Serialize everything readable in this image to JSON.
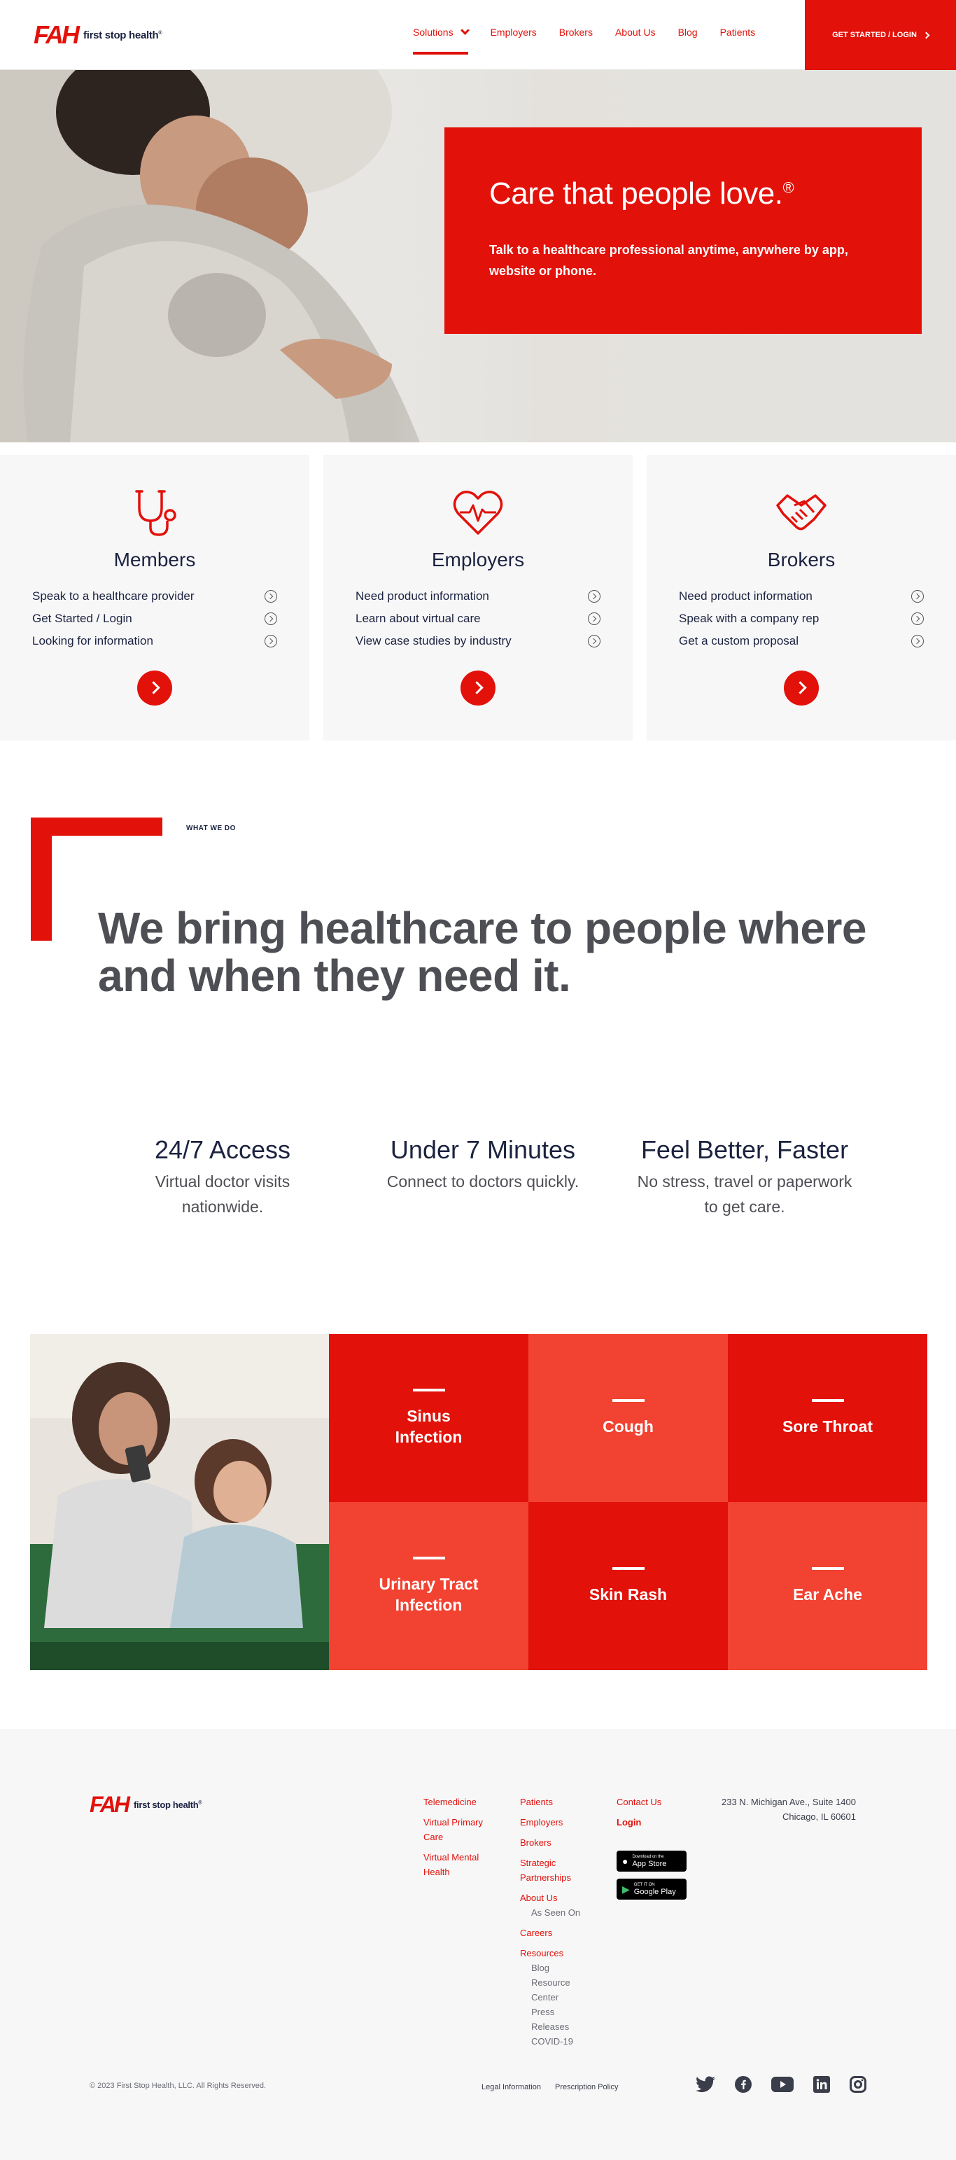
{
  "header": {
    "logo_mark": "FAH",
    "logo_text": "first stop health",
    "nav": [
      {
        "label": "Solutions"
      },
      {
        "label": "Employers"
      },
      {
        "label": "Brokers"
      },
      {
        "label": "About Us"
      },
      {
        "label": "Blog"
      },
      {
        "label": "Patients"
      }
    ],
    "cta_label": "GET STARTED / LOGIN"
  },
  "hero": {
    "title": "Care that people love.",
    "title_mark": "®",
    "subtitle": "Talk to a healthcare professional anytime, anywhere by app, website or phone."
  },
  "cards": [
    {
      "title": "Members",
      "icon": "stethoscope-icon",
      "links": [
        "Speak to a healthcare provider",
        "Get Started / Login",
        "Looking for information"
      ]
    },
    {
      "title": "Employers",
      "icon": "heart-pulse-icon",
      "links": [
        "Need product information",
        "Learn about virtual care",
        "View case studies by industry"
      ]
    },
    {
      "title": "Brokers",
      "icon": "handshake-icon",
      "links": [
        "Need product information",
        "Speak with a company rep",
        "Get a custom proposal"
      ]
    }
  ],
  "what_we_do": {
    "eyebrow": "WHAT WE DO",
    "heading": "We bring healthcare to people where and when they need it."
  },
  "stats": [
    {
      "title": "24/7 Access",
      "desc": "Virtual doctor visits nationwide."
    },
    {
      "title": "Under 7 Minutes",
      "desc": "Connect to doctors quickly."
    },
    {
      "title": "Feel Better, Faster",
      "desc": "No stress, travel or paperwork to get care."
    }
  ],
  "conditions": [
    "Sinus Infection",
    "Cough",
    "Sore Throat",
    "Urinary Tract Infection",
    "Skin Rash",
    "Ear Ache"
  ],
  "footer": {
    "col1": [
      "Telemedicine",
      "Virtual Primary Care",
      "Virtual Mental Health"
    ],
    "col2": {
      "patients": "Patients",
      "employers": "Employers",
      "brokers": "Brokers",
      "strategic": "Strategic Partnerships",
      "about": "About Us",
      "as_seen_on": "As Seen On",
      "careers": "Careers",
      "resources": "Resources",
      "blog": "Blog",
      "resource_center": "Resource Center",
      "press": "Press Releases",
      "covid": "COVID-19"
    },
    "contact": "Contact Us",
    "login": "Login",
    "app_store_small": "Download on the",
    "app_store": "App Store",
    "google_small": "GET IT ON",
    "google": "Google Play",
    "address_line1": "233 N. Michigan Ave., Suite 1400",
    "address_line2": "Chicago, IL 60601",
    "copyright": "© 2023 First Stop Health, LLC. All Rights Reserved.",
    "legal": "Legal Information",
    "privacy": "Prescription Policy",
    "social": [
      "twitter-icon",
      "facebook-icon",
      "youtube-icon",
      "linkedin-icon",
      "instagram-icon"
    ]
  },
  "colors": {
    "brand_red": "#e2110a",
    "light_red": "#f24231",
    "navy": "#1c2340",
    "gray_heading": "#4e4f55"
  }
}
